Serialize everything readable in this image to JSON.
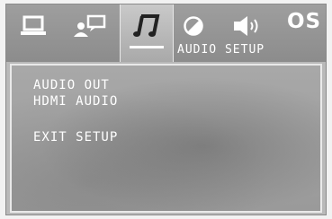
{
  "header": {
    "tabs": [
      {
        "icon": "monitor-icon"
      },
      {
        "icon": "users-chat-icon"
      },
      {
        "icon": "music-note-icon",
        "active": true
      },
      {
        "icon": "contrast-icon"
      },
      {
        "icon": "speaker-icon"
      }
    ],
    "os_label": "OS",
    "section_title": "AUDIO SETUP"
  },
  "menu": {
    "items": [
      "AUDIO OUT",
      "HDMI AUDIO",
      "EXIT SETUP"
    ]
  },
  "colors": {
    "text": "#ffffff",
    "panel_border": "#e9e9e9"
  }
}
